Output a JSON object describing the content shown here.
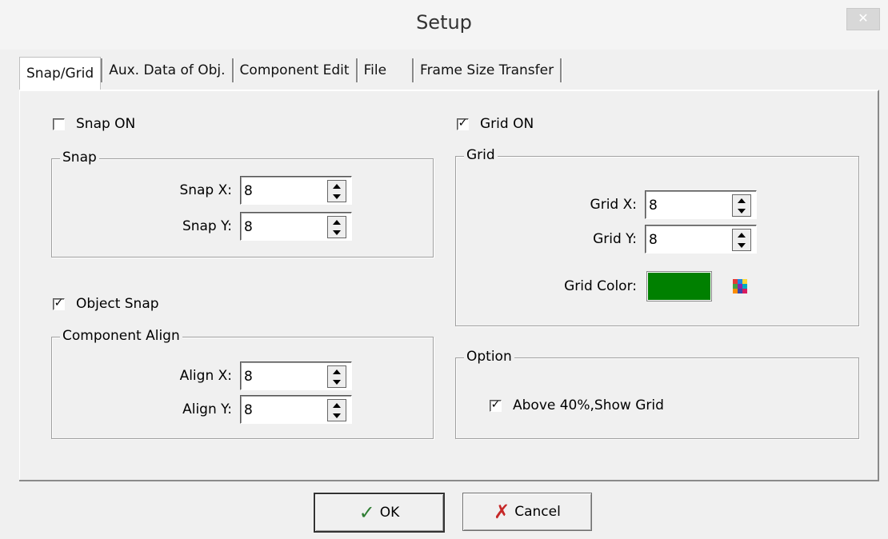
{
  "window": {
    "title": "Setup",
    "close_label": "✕"
  },
  "tabs": [
    {
      "label": "Snap/Grid"
    },
    {
      "label": "Aux. Data of Obj."
    },
    {
      "label": "Component Edit"
    },
    {
      "label": "File"
    },
    {
      "label": "Frame Size Transfer"
    }
  ],
  "snap": {
    "checkbox_label": "Snap ON",
    "checked": false,
    "group_title": "Snap",
    "x_label": "Snap X:",
    "x_value": "8",
    "y_label": "Snap Y:",
    "y_value": "8"
  },
  "object_snap": {
    "checkbox_label": "Object Snap",
    "checked": true
  },
  "component_align": {
    "group_title": "Component Align",
    "x_label": "Align X:",
    "x_value": "8",
    "y_label": "Align Y:",
    "y_value": "8"
  },
  "grid": {
    "checkbox_label": "Grid ON",
    "checked": true,
    "group_title": "Grid",
    "x_label": "Grid X:",
    "x_value": "8",
    "y_label": "Grid Y:",
    "y_value": "8",
    "color_label": "Grid Color:",
    "color": "#008000",
    "palette_icon": "color-palette-icon"
  },
  "option": {
    "group_title": "Option",
    "checkbox_label": "Above 40%,Show Grid",
    "checked": true
  },
  "buttons": {
    "ok_label": "OK",
    "ok_icon": "checkmark-icon",
    "ok_icon_color": "#2e7d32",
    "cancel_label": "Cancel",
    "cancel_icon": "x-icon",
    "cancel_icon_color": "#c62828"
  },
  "check_mark": "✓"
}
